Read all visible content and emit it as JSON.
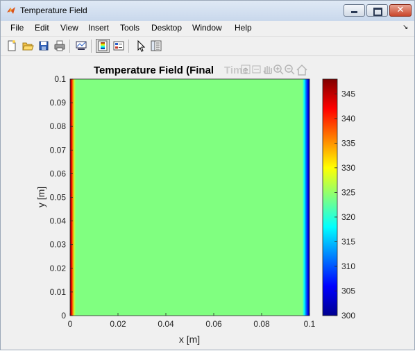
{
  "window": {
    "title": "Temperature Field",
    "minimize_icon": "minimize-icon",
    "maximize_icon": "maximize-icon",
    "close_icon": "close-icon"
  },
  "menu": {
    "items": [
      "File",
      "Edit",
      "View",
      "Insert",
      "Tools",
      "Desktop",
      "Window",
      "Help"
    ],
    "overflow_icon": "dock-arrow-icon"
  },
  "toolbar": {
    "buttons": [
      "new-figure",
      "open-file",
      "save",
      "print",
      "link-plot",
      "colorbar-toggle",
      "legend-toggle",
      "edit-plot-arrow",
      "property-inspector"
    ],
    "pressed": "colorbar-toggle"
  },
  "axes_toolbar": {
    "buttons": [
      "export",
      "brush",
      "pan",
      "zoom-in",
      "zoom-out",
      "home"
    ]
  },
  "chart_data": {
    "type": "heatmap",
    "title": "Temperature Field (Final",
    "title_overlap_text": "Time",
    "xlabel": "x [m]",
    "ylabel": "y [m]",
    "xlim": [
      0,
      0.1
    ],
    "ylim": [
      0,
      0.1
    ],
    "xticks": [
      "0",
      "0.02",
      "0.04",
      "0.06",
      "0.08",
      "0.1"
    ],
    "yticks": [
      "0",
      "0.01",
      "0.02",
      "0.03",
      "0.04",
      "0.05",
      "0.06",
      "0.07",
      "0.08",
      "0.09",
      "0.1"
    ],
    "colorbar": {
      "range": [
        300,
        348
      ],
      "ticks": [
        "300",
        "305",
        "310",
        "315",
        "320",
        "325",
        "330",
        "335",
        "340",
        "345"
      ],
      "colormap": "jet"
    },
    "field_profile_x": [
      {
        "x": 0.0,
        "t": 348
      },
      {
        "x": 0.0006,
        "t": 343
      },
      {
        "x": 0.0012,
        "t": 335
      },
      {
        "x": 0.0018,
        "t": 327
      },
      {
        "x": 0.0024,
        "t": 324
      },
      {
        "x": 0.097,
        "t": 324
      },
      {
        "x": 0.0978,
        "t": 318
      },
      {
        "x": 0.0986,
        "t": 311
      },
      {
        "x": 0.0994,
        "t": 305
      },
      {
        "x": 0.1,
        "t": 300
      }
    ],
    "grid": false
  }
}
